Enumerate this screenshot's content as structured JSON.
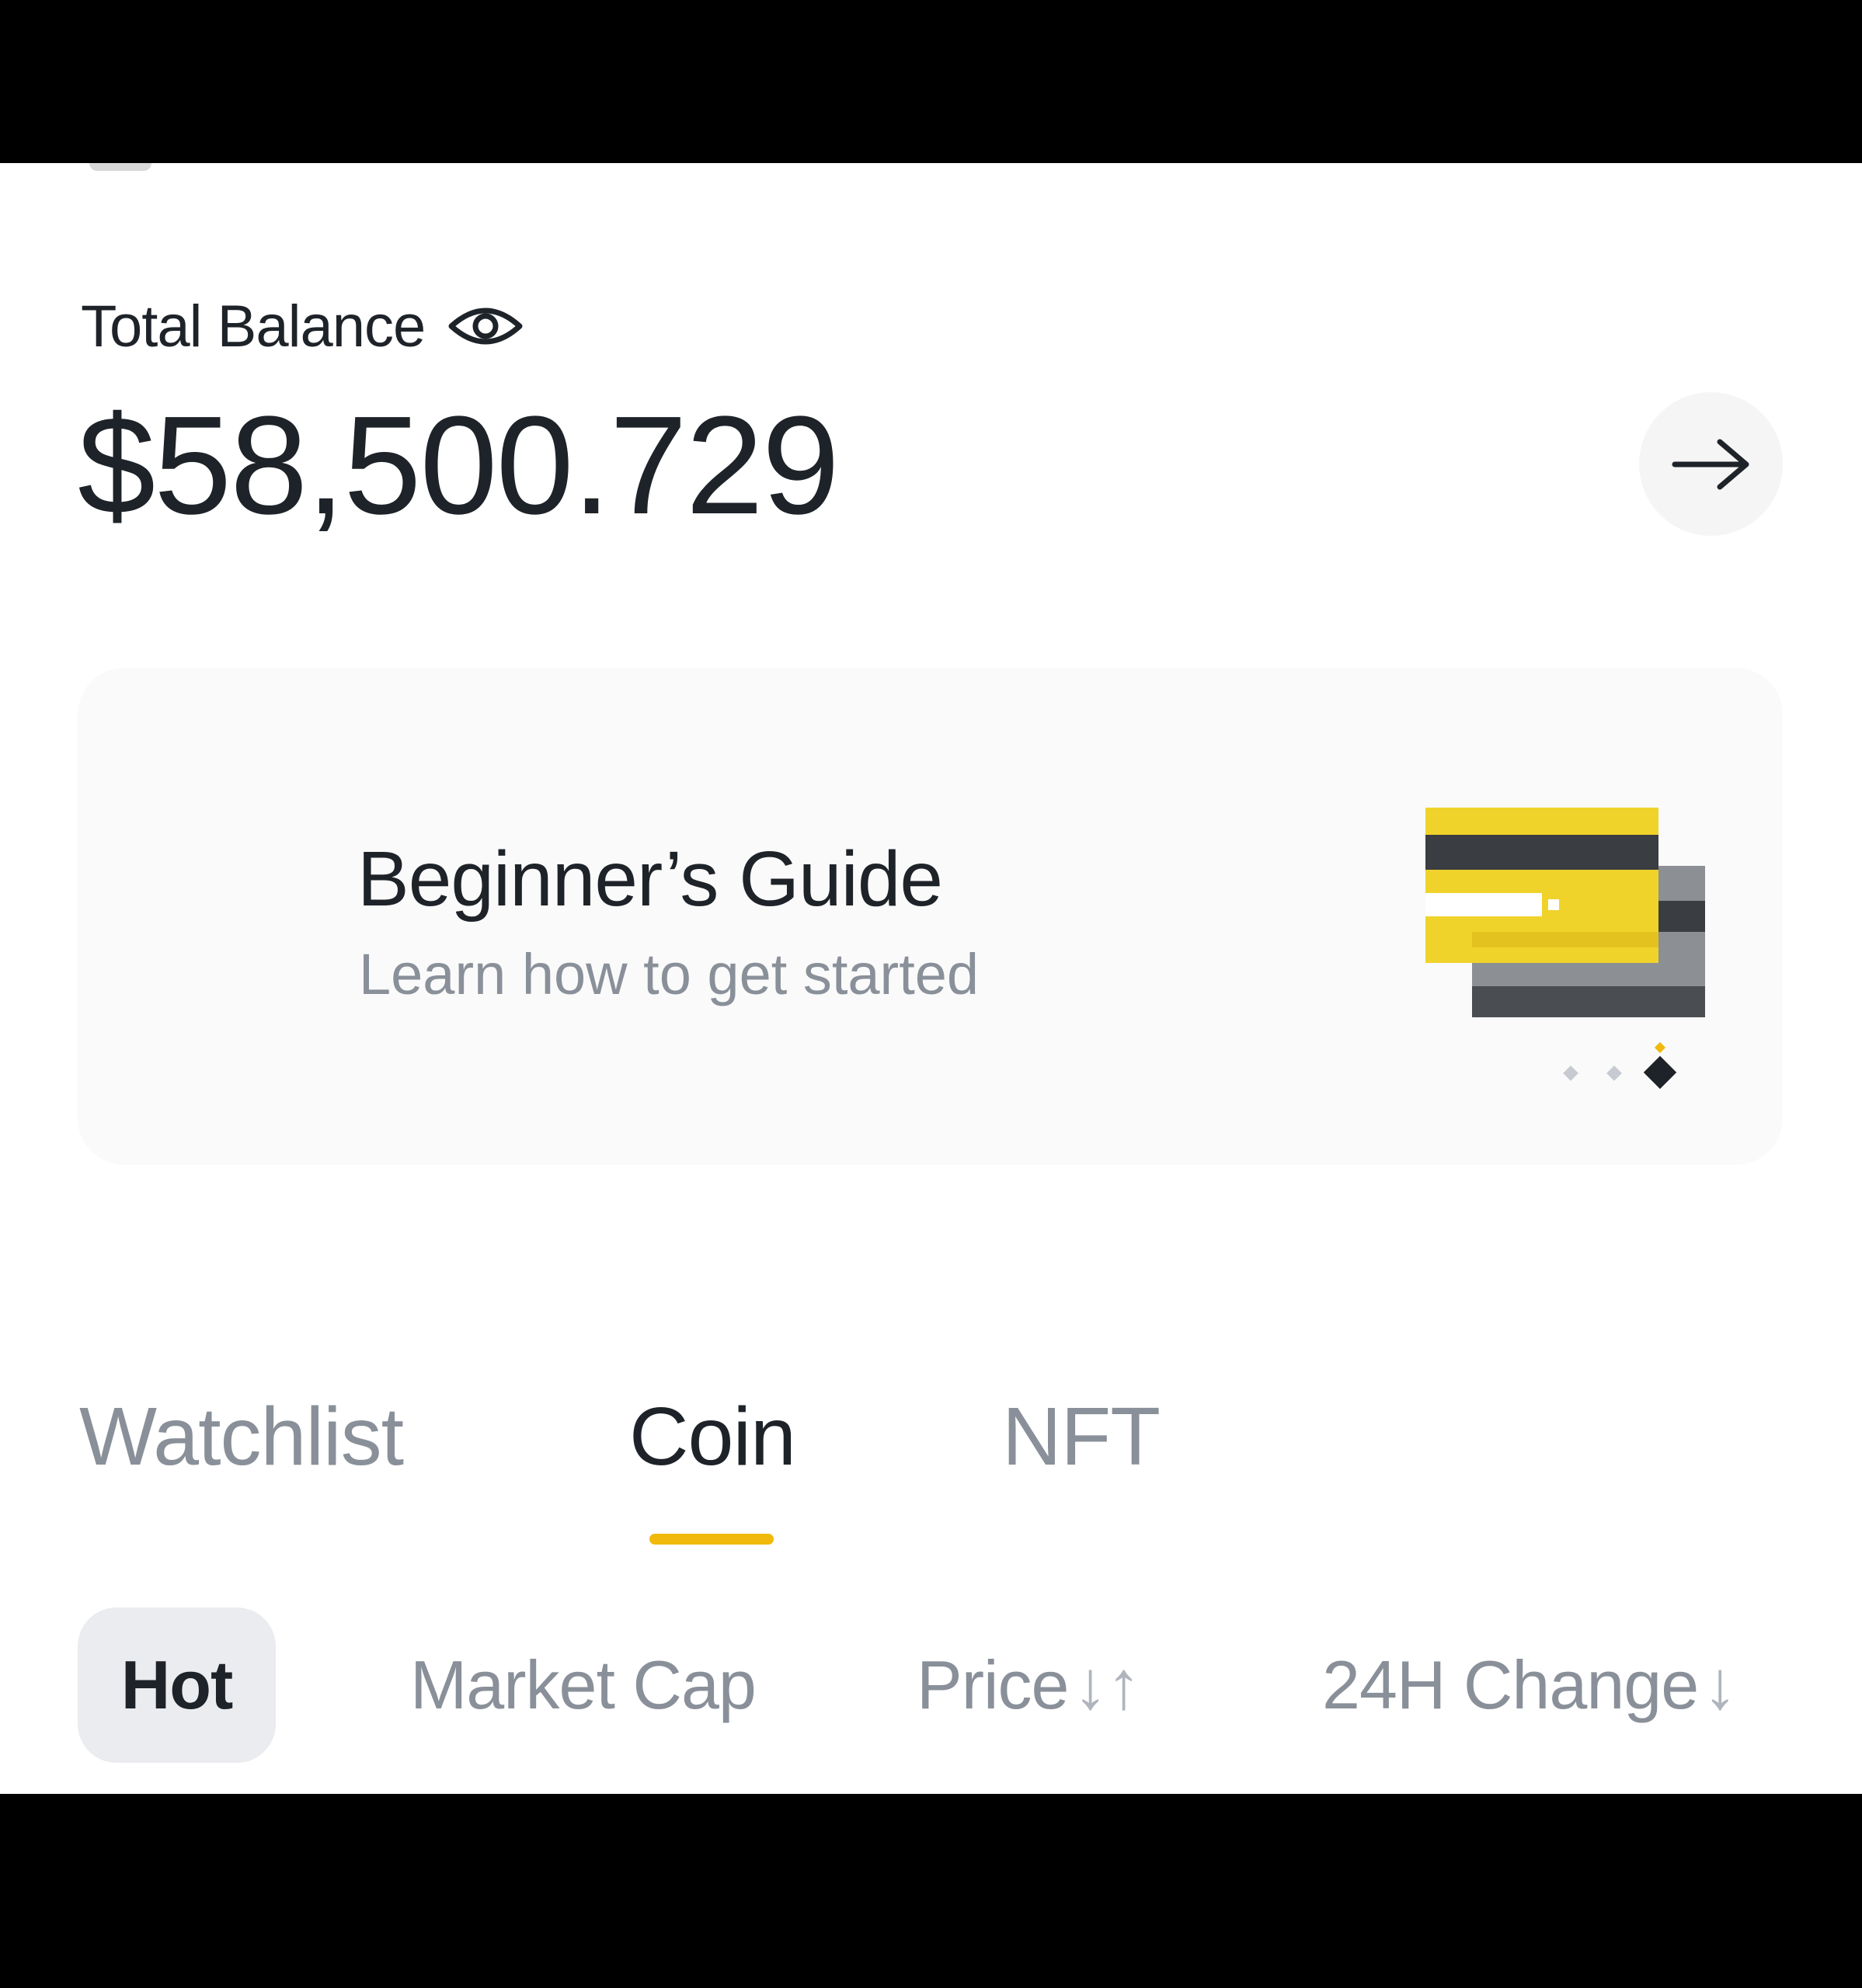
{
  "balance": {
    "label": "Total Balance",
    "value": "$58,500.729",
    "eye_icon": "eye-icon",
    "arrow_icon": "arrow-right-icon"
  },
  "guide": {
    "title": "Beginner’s Guide",
    "subtitle": "Learn how to get started",
    "illustration_icon": "cards-illustration-icon",
    "accent_color": "#f0d32a",
    "pager": {
      "total": 3,
      "active_index": 2
    }
  },
  "tabs": [
    {
      "label": "Watchlist",
      "active": false
    },
    {
      "label": "Coin",
      "active": true
    },
    {
      "label": "NFT",
      "active": false
    }
  ],
  "filters": [
    {
      "label": "Hot",
      "selected": true,
      "sort": ""
    },
    {
      "label": "Market Cap",
      "selected": false,
      "sort": ""
    },
    {
      "label": "Price",
      "selected": false,
      "sort": "↓↑"
    },
    {
      "label": "24H Change",
      "selected": false,
      "sort": "↓"
    }
  ],
  "colors": {
    "accent": "#f0b90b",
    "text_primary": "#1e2329",
    "text_secondary": "#8a9099"
  }
}
